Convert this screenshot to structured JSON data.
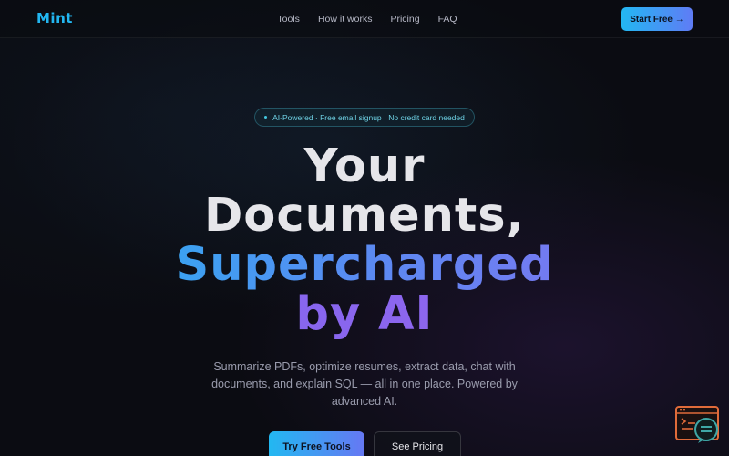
{
  "nav": {
    "logo": "Mint",
    "links": [
      "Tools",
      "How it works",
      "Pricing",
      "FAQ"
    ],
    "cta_label": "Start Free →"
  },
  "badge": {
    "text": "AI-Powered · Free email signup · No credit card needed"
  },
  "hero": {
    "line1": "Your",
    "line2": "Documents,",
    "line3": "Supercharged",
    "line4": "by AI",
    "subtitle": "Summarize PDFs, optimize resumes, extract data, chat with documents, and explain SQL — all in one place. Powered by advanced AI.",
    "primary_cta": "Try Free Tools",
    "secondary_cta": "See Pricing"
  },
  "widget": {
    "icon": "chat-support-icon"
  },
  "colors": {
    "background": "#0b0c12",
    "accent_cyan": "#22b6f0",
    "accent_purple": "#8b6cf0",
    "widget_orange": "#e06b3a",
    "widget_teal": "#3fa7a6"
  }
}
